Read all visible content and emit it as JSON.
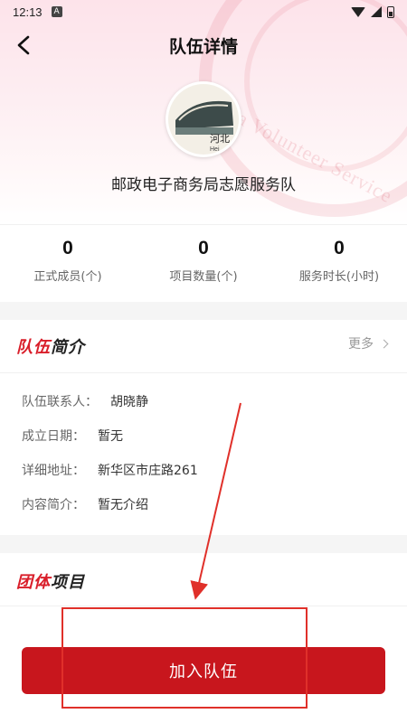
{
  "status_bar": {
    "time": "12:13",
    "notification_badge": "A"
  },
  "nav": {
    "title": "队伍详情"
  },
  "team": {
    "name": "邮政电子商务局志愿服务队",
    "avatar_caption": "河北",
    "avatar_caption_sub": "Hei"
  },
  "watermark": {
    "text": "China Volunteer Service",
    "mark": "志"
  },
  "stats": [
    {
      "value": "0",
      "label": "正式成员(个)"
    },
    {
      "value": "0",
      "label": "项目数量(个)"
    },
    {
      "value": "0",
      "label": "服务时长(小时)"
    }
  ],
  "intro": {
    "title_red": "队伍",
    "title_dark": "简介",
    "more_label": "更多",
    "rows": [
      {
        "label": "队伍联系人：",
        "value": "胡晓静"
      },
      {
        "label": "成立日期：",
        "value": "暂无"
      },
      {
        "label": "详细地址：",
        "value": "新华区市庄路261"
      },
      {
        "label": "内容简介：",
        "value": "暂无介绍"
      }
    ]
  },
  "projects": {
    "title_red": "团体",
    "title_dark": "项目"
  },
  "join_button": {
    "label": "加入队伍"
  },
  "colors": {
    "brand_red": "#c8161d",
    "title_red": "#d91e2a",
    "annotation_red": "#e0302a"
  }
}
